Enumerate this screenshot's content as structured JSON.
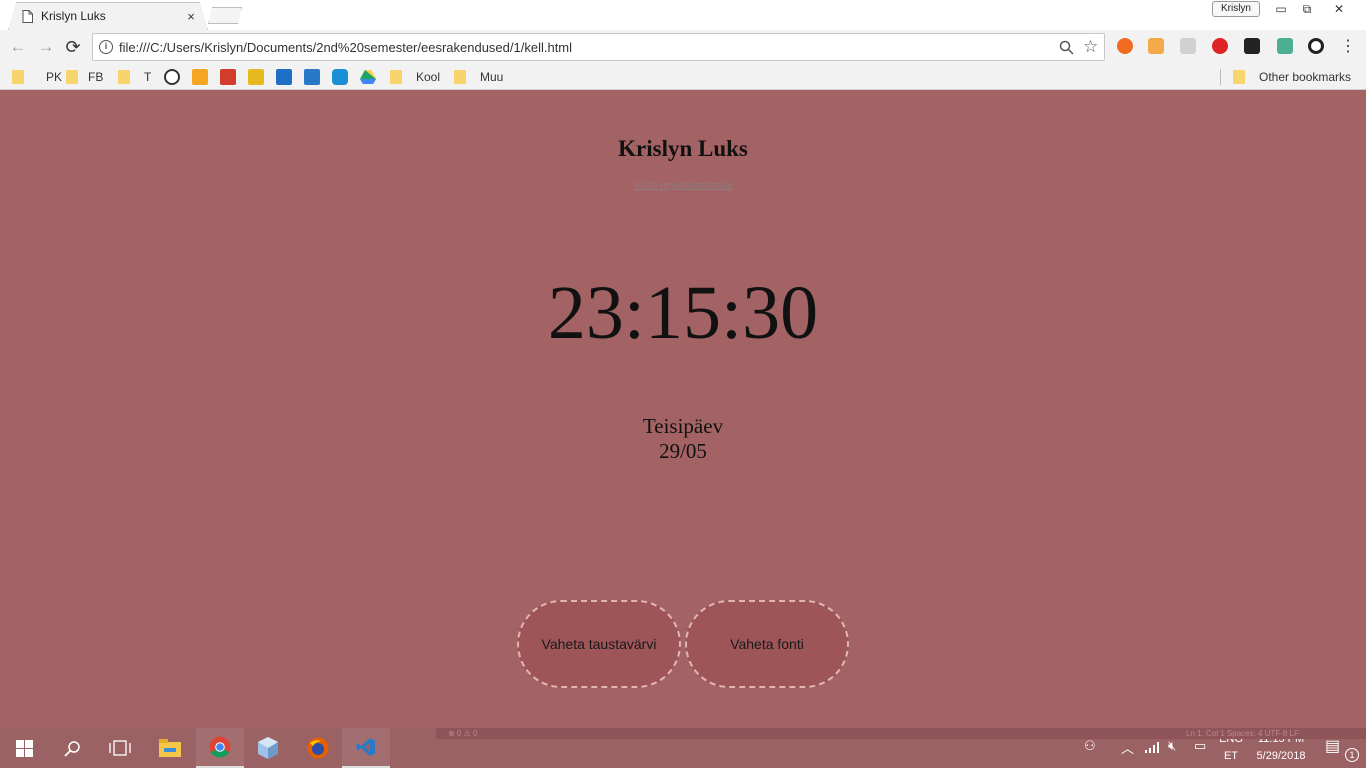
{
  "browser": {
    "tab_title": "Krislyn Luks",
    "tab_close": "×",
    "profile_name": "Krislyn",
    "url": "file:///C:/Users/Krislyn/Documents/2nd%20semester/eesrakendused/1/kell.html",
    "bookmarks": [
      "PK",
      "FB",
      "T",
      "Kool",
      "Muu"
    ],
    "other_bookmarks": "Other bookmarks"
  },
  "page": {
    "name": "Krislyn Luks",
    "repo_link": "Viide repositooriumile",
    "time": "23:15:30",
    "weekday": "Teisipäev",
    "date": "29/05",
    "buttons": {
      "change_background": "Vaheta taustavärvi",
      "change_font": "Vaheta fonti"
    },
    "background_color": "#a36364"
  },
  "editor_status": {
    "problems": "⊗ 0 ⚠ 0",
    "position": "Ln 1, Col 1   Spaces: 4   UTF-8   LF"
  },
  "taskbar": {
    "language_top": "ENG",
    "language_bottom": "ET",
    "time": "11:15 PM",
    "date": "5/29/2018",
    "notifications": "1"
  }
}
